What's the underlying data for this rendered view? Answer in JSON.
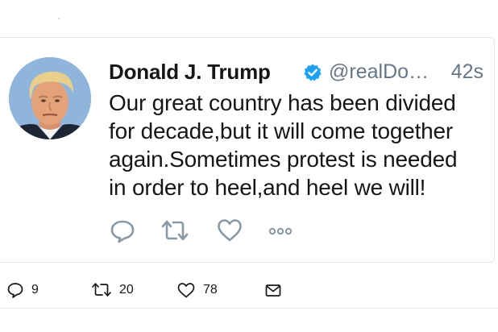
{
  "tweet": {
    "display_name": "Donald J. Trump",
    "handle": "@realDo…",
    "timestamp": "42s",
    "verified": true,
    "text_lines": [
      "Our great country has been divided",
      "for decade,but it will come together",
      "again.Sometimes protest is needed",
      "in order to heel,and heel we will!"
    ],
    "actions": [
      {
        "name": "reply-icon"
      },
      {
        "name": "retweet-icon"
      },
      {
        "name": "like-icon"
      },
      {
        "name": "more-icon"
      }
    ]
  },
  "stats": {
    "replies": "9",
    "retweets": "20",
    "likes": "78",
    "dm_icon": "envelope-icon"
  },
  "colors": {
    "text": "#14171a",
    "secondary": "#657786",
    "icon": "#8899a6",
    "verified": "#1da1f2",
    "border": "#e1e8ed"
  }
}
